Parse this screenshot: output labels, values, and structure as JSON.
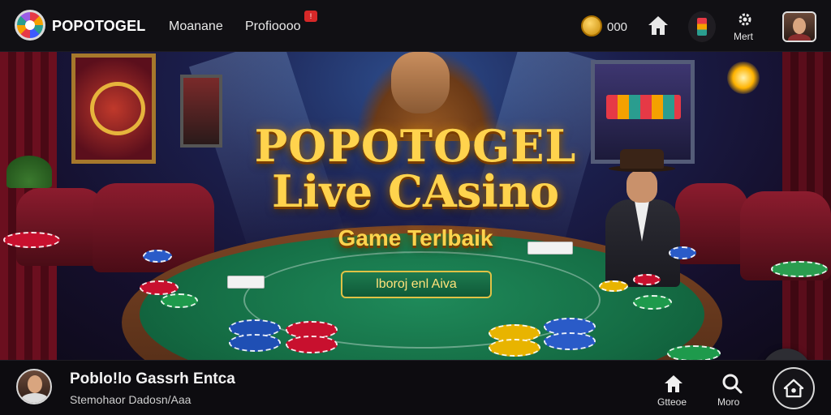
{
  "header": {
    "brand": "POPOTOGEL",
    "nav": [
      {
        "label": "Moanane"
      },
      {
        "label": "Profioooo"
      }
    ],
    "promo_badge": "!",
    "coin_balance": "000",
    "more_label": "Mert"
  },
  "hero": {
    "title_line1": "POPOTOGEL",
    "title_line2": "Live CAsino",
    "subtitle": "Game Terlbaik",
    "cta_label": "lboroj enl Aiva"
  },
  "footer": {
    "title": "Poblo!lo Gassrh Entca",
    "subtitle": "Stemohaor Dadosn/Aaa",
    "nav": [
      {
        "label": "Gtteoe",
        "icon": "home-icon"
      },
      {
        "label": "Moro",
        "icon": "search-icon"
      }
    ]
  },
  "colors": {
    "title_gold": "#ffd34d",
    "felt_green": "#146b43",
    "topbar_bg": "#111014",
    "accent_red": "#d62828"
  }
}
